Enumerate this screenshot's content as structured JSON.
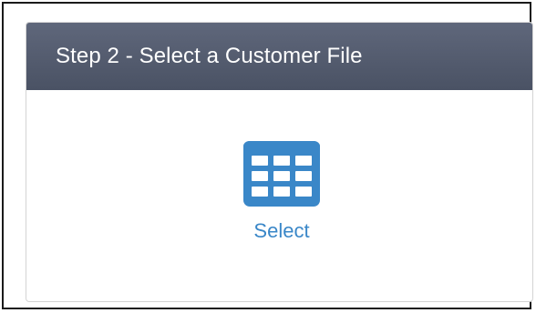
{
  "panel": {
    "title": "Step 2 - Select a Customer File"
  },
  "action": {
    "label": "Select",
    "icon": "table-grid-icon",
    "color": "#3a87c8"
  },
  "colors": {
    "header": "#535b6e",
    "accent": "#3a87c8"
  }
}
